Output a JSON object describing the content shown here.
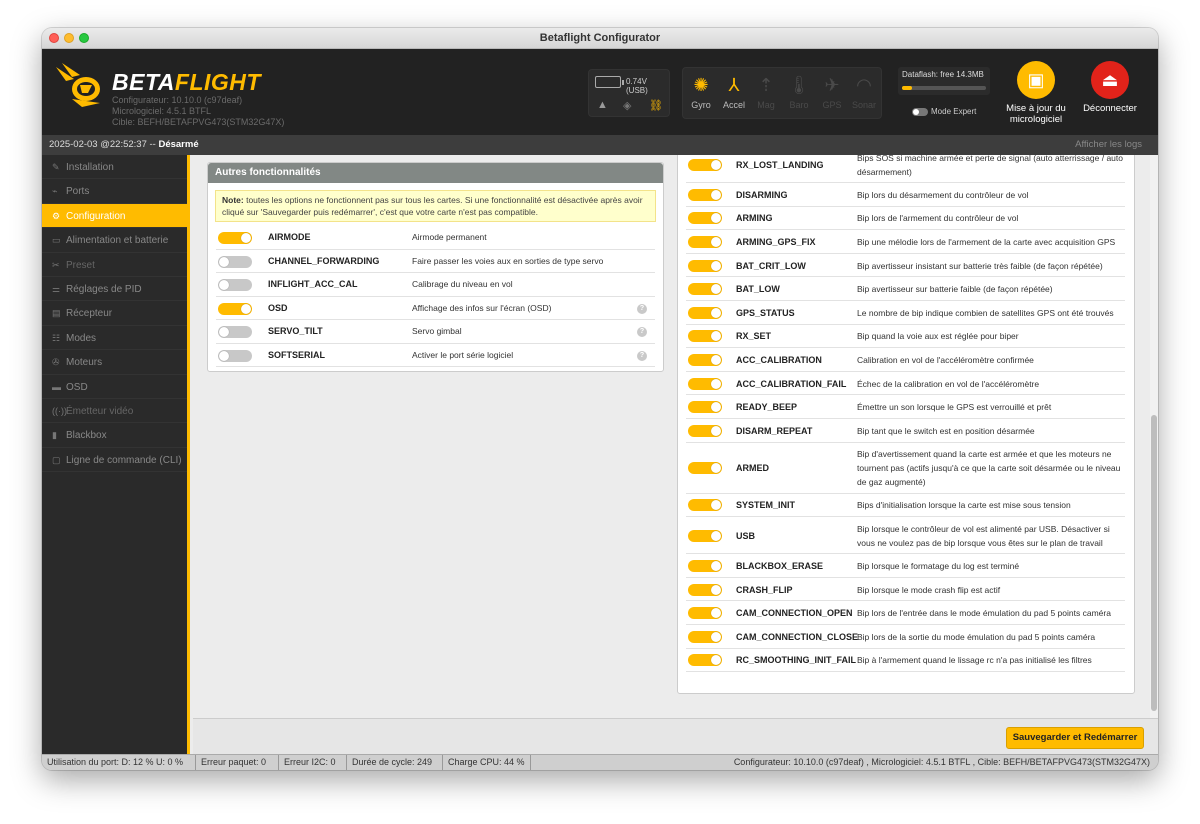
{
  "window": {
    "title": "Betaflight Configurator"
  },
  "header": {
    "logo_main": "BETA",
    "logo_accent": "FLIGHT",
    "configurator_version": "Configurateur: 10.10.0 (c97deaf)",
    "firmware_version": "Micrologiciel: 4.5.1 BTFL",
    "target": "Cible: BEFH/BETAFPVG473(STM32G47X)",
    "voltage": "0.74V (USB)",
    "sensors": [
      {
        "label": "Gyro",
        "icon": "gyro-icon",
        "active": true
      },
      {
        "label": "Accel",
        "icon": "accel-icon",
        "active": true
      },
      {
        "label": "Mag",
        "icon": "mag-icon",
        "active": false
      },
      {
        "label": "Baro",
        "icon": "baro-icon",
        "active": false
      },
      {
        "label": "GPS",
        "icon": "gps-icon",
        "active": false
      },
      {
        "label": "Sonar",
        "icon": "sonar-icon",
        "active": false
      }
    ],
    "dataflash": "Dataflash: free 14.3MB",
    "dataflash_used_fraction": 0.12,
    "expert_mode": "Mode Expert",
    "update_button": "Mise à jour du micrologiciel",
    "disconnect_button": "Déconnecter"
  },
  "statusline": {
    "datetime": "2025-02-03 @22:52:37 -- ",
    "arm_state": "Désarmé",
    "show_logs": "Afficher les logs"
  },
  "sidebar": {
    "items": [
      {
        "label": "Installation",
        "name": "sidebar-item-installation",
        "active": false
      },
      {
        "label": "Ports",
        "name": "sidebar-item-ports",
        "active": false
      },
      {
        "label": "Configuration",
        "name": "sidebar-item-configuration",
        "active": true
      },
      {
        "label": "Alimentation et batterie",
        "name": "sidebar-item-power",
        "active": false
      },
      {
        "label": "Preset",
        "name": "sidebar-item-preset",
        "active": false
      },
      {
        "label": "Réglages de PID",
        "name": "sidebar-item-pid",
        "active": false
      },
      {
        "label": "Récepteur",
        "name": "sidebar-item-receiver",
        "active": false
      },
      {
        "label": "Modes",
        "name": "sidebar-item-modes",
        "active": false
      },
      {
        "label": "Moteurs",
        "name": "sidebar-item-motors",
        "active": false
      },
      {
        "label": "OSD",
        "name": "sidebar-item-osd",
        "active": false
      },
      {
        "label": "Émetteur vidéo",
        "name": "sidebar-item-vtx",
        "active": false
      },
      {
        "label": "Blackbox",
        "name": "sidebar-item-blackbox",
        "active": false
      },
      {
        "label": "Ligne de commande (CLI)",
        "name": "sidebar-item-cli",
        "active": false
      }
    ]
  },
  "features": {
    "title": "Autres fonctionnalités",
    "note_bold": "Note:",
    "note_text": " toutes les options ne fonctionnent pas sur tous les cartes. Si une fonctionnalité est désactivée après avoir cliqué sur 'Sauvegarder puis redémarrer', c'est que votre carte n'est pas compatible.",
    "rows": [
      {
        "name": "AIRMODE",
        "desc": "Airmode permanent",
        "enabled": true,
        "help": false
      },
      {
        "name": "CHANNEL_FORWARDING",
        "desc": "Faire passer les voies aux en sorties de type servo",
        "enabled": false,
        "help": false
      },
      {
        "name": "INFLIGHT_ACC_CAL",
        "desc": "Calibrage du niveau en vol",
        "enabled": false,
        "help": false
      },
      {
        "name": "OSD",
        "desc": "Affichage des infos sur l'écran (OSD)",
        "enabled": true,
        "help": true
      },
      {
        "name": "SERVO_TILT",
        "desc": "Servo gimbal",
        "enabled": false,
        "help": true
      },
      {
        "name": "SOFTSERIAL",
        "desc": "Activer le port série logiciel",
        "enabled": false,
        "help": true
      }
    ]
  },
  "beepers": {
    "rows": [
      {
        "name": "RX_LOST_LANDING",
        "desc": "Bips SOS si machine armée et perte de signal (auto atterrissage / auto désarmement)",
        "enabled": true,
        "lines": 2
      },
      {
        "name": "DISARMING",
        "desc": "Bip lors du désarmement du contrôleur de vol",
        "enabled": true,
        "lines": 1
      },
      {
        "name": "ARMING",
        "desc": "Bip lors de l'armement du contrôleur de vol",
        "enabled": true,
        "lines": 1
      },
      {
        "name": "ARMING_GPS_FIX",
        "desc": "Bip une mélodie lors de l'armement de la carte avec acquisition GPS",
        "enabled": true,
        "lines": 1
      },
      {
        "name": "BAT_CRIT_LOW",
        "desc": "Bip avertisseur insistant sur batterie très faible (de façon répétée)",
        "enabled": true,
        "lines": 1
      },
      {
        "name": "BAT_LOW",
        "desc": "Bip avertisseur sur batterie faible (de façon répétée)",
        "enabled": true,
        "lines": 1
      },
      {
        "name": "GPS_STATUS",
        "desc": "Le nombre de bip indique combien de satellites GPS ont été trouvés",
        "enabled": true,
        "lines": 1
      },
      {
        "name": "RX_SET",
        "desc": "Bip quand la voie aux est réglée pour biper",
        "enabled": true,
        "lines": 1
      },
      {
        "name": "ACC_CALIBRATION",
        "desc": "Calibration en vol de l'accéléromètre confirmée",
        "enabled": true,
        "lines": 1
      },
      {
        "name": "ACC_CALIBRATION_FAIL",
        "desc": "Échec de la calibration en vol de l'accéléromètre",
        "enabled": true,
        "lines": 1
      },
      {
        "name": "READY_BEEP",
        "desc": "Émettre un son lorsque le GPS est verrouillé et prêt",
        "enabled": true,
        "lines": 1
      },
      {
        "name": "DISARM_REPEAT",
        "desc": "Bip tant que le switch est en position désarmée",
        "enabled": true,
        "lines": 1
      },
      {
        "name": "ARMED",
        "desc": "Bip d'avertissement quand la carte est armée et que les moteurs ne tournent pas (actifs jusqu'à ce que la carte soit désarmée ou le niveau de gaz augmenté)",
        "enabled": true,
        "lines": 3
      },
      {
        "name": "SYSTEM_INIT",
        "desc": "Bips d'initialisation lorsque la carte est mise sous tension",
        "enabled": true,
        "lines": 1
      },
      {
        "name": "USB",
        "desc": "Bip lorsque le contrôleur de vol est alimenté par USB. Désactiver si vous ne voulez pas de bip lorsque vous êtes sur le plan de travail",
        "enabled": true,
        "lines": 2
      },
      {
        "name": "BLACKBOX_ERASE",
        "desc": "Bip lorsque le formatage du log est terminé",
        "enabled": true,
        "lines": 1
      },
      {
        "name": "CRASH_FLIP",
        "desc": "Bip lorsque le mode crash flip est actif",
        "enabled": true,
        "lines": 1
      },
      {
        "name": "CAM_CONNECTION_OPEN",
        "desc": "Bip lors de l'entrée dans le mode émulation du pad 5 points caméra",
        "enabled": true,
        "lines": 1
      },
      {
        "name": "CAM_CONNECTION_CLOSE",
        "desc": "Bip lors de la sortie du mode émulation du pad 5 points caméra",
        "enabled": true,
        "lines": 1
      },
      {
        "name": "RC_SMOOTHING_INIT_FAIL",
        "desc": "Bip à l'armement quand le lissage rc n'a pas initialisé les filtres",
        "enabled": true,
        "lines": 1
      }
    ]
  },
  "footer": {
    "save_button": "Sauvegarder et Redémarrer"
  },
  "bottom_status": {
    "port_usage": "Utilisation du port: D: 12 % U: 0 %",
    "packet_error": "Erreur paquet: 0",
    "i2c_error": "Erreur I2C: 0",
    "cycle_time": "Durée de cycle: 249",
    "cpu_load": "Charge CPU: 44 %",
    "versions": "Configurateur: 10.10.0 (c97deaf) , Micrologiciel: 4.5.1 BTFL , Cible: BEFH/BETAFPVG473(STM32G47X)"
  }
}
